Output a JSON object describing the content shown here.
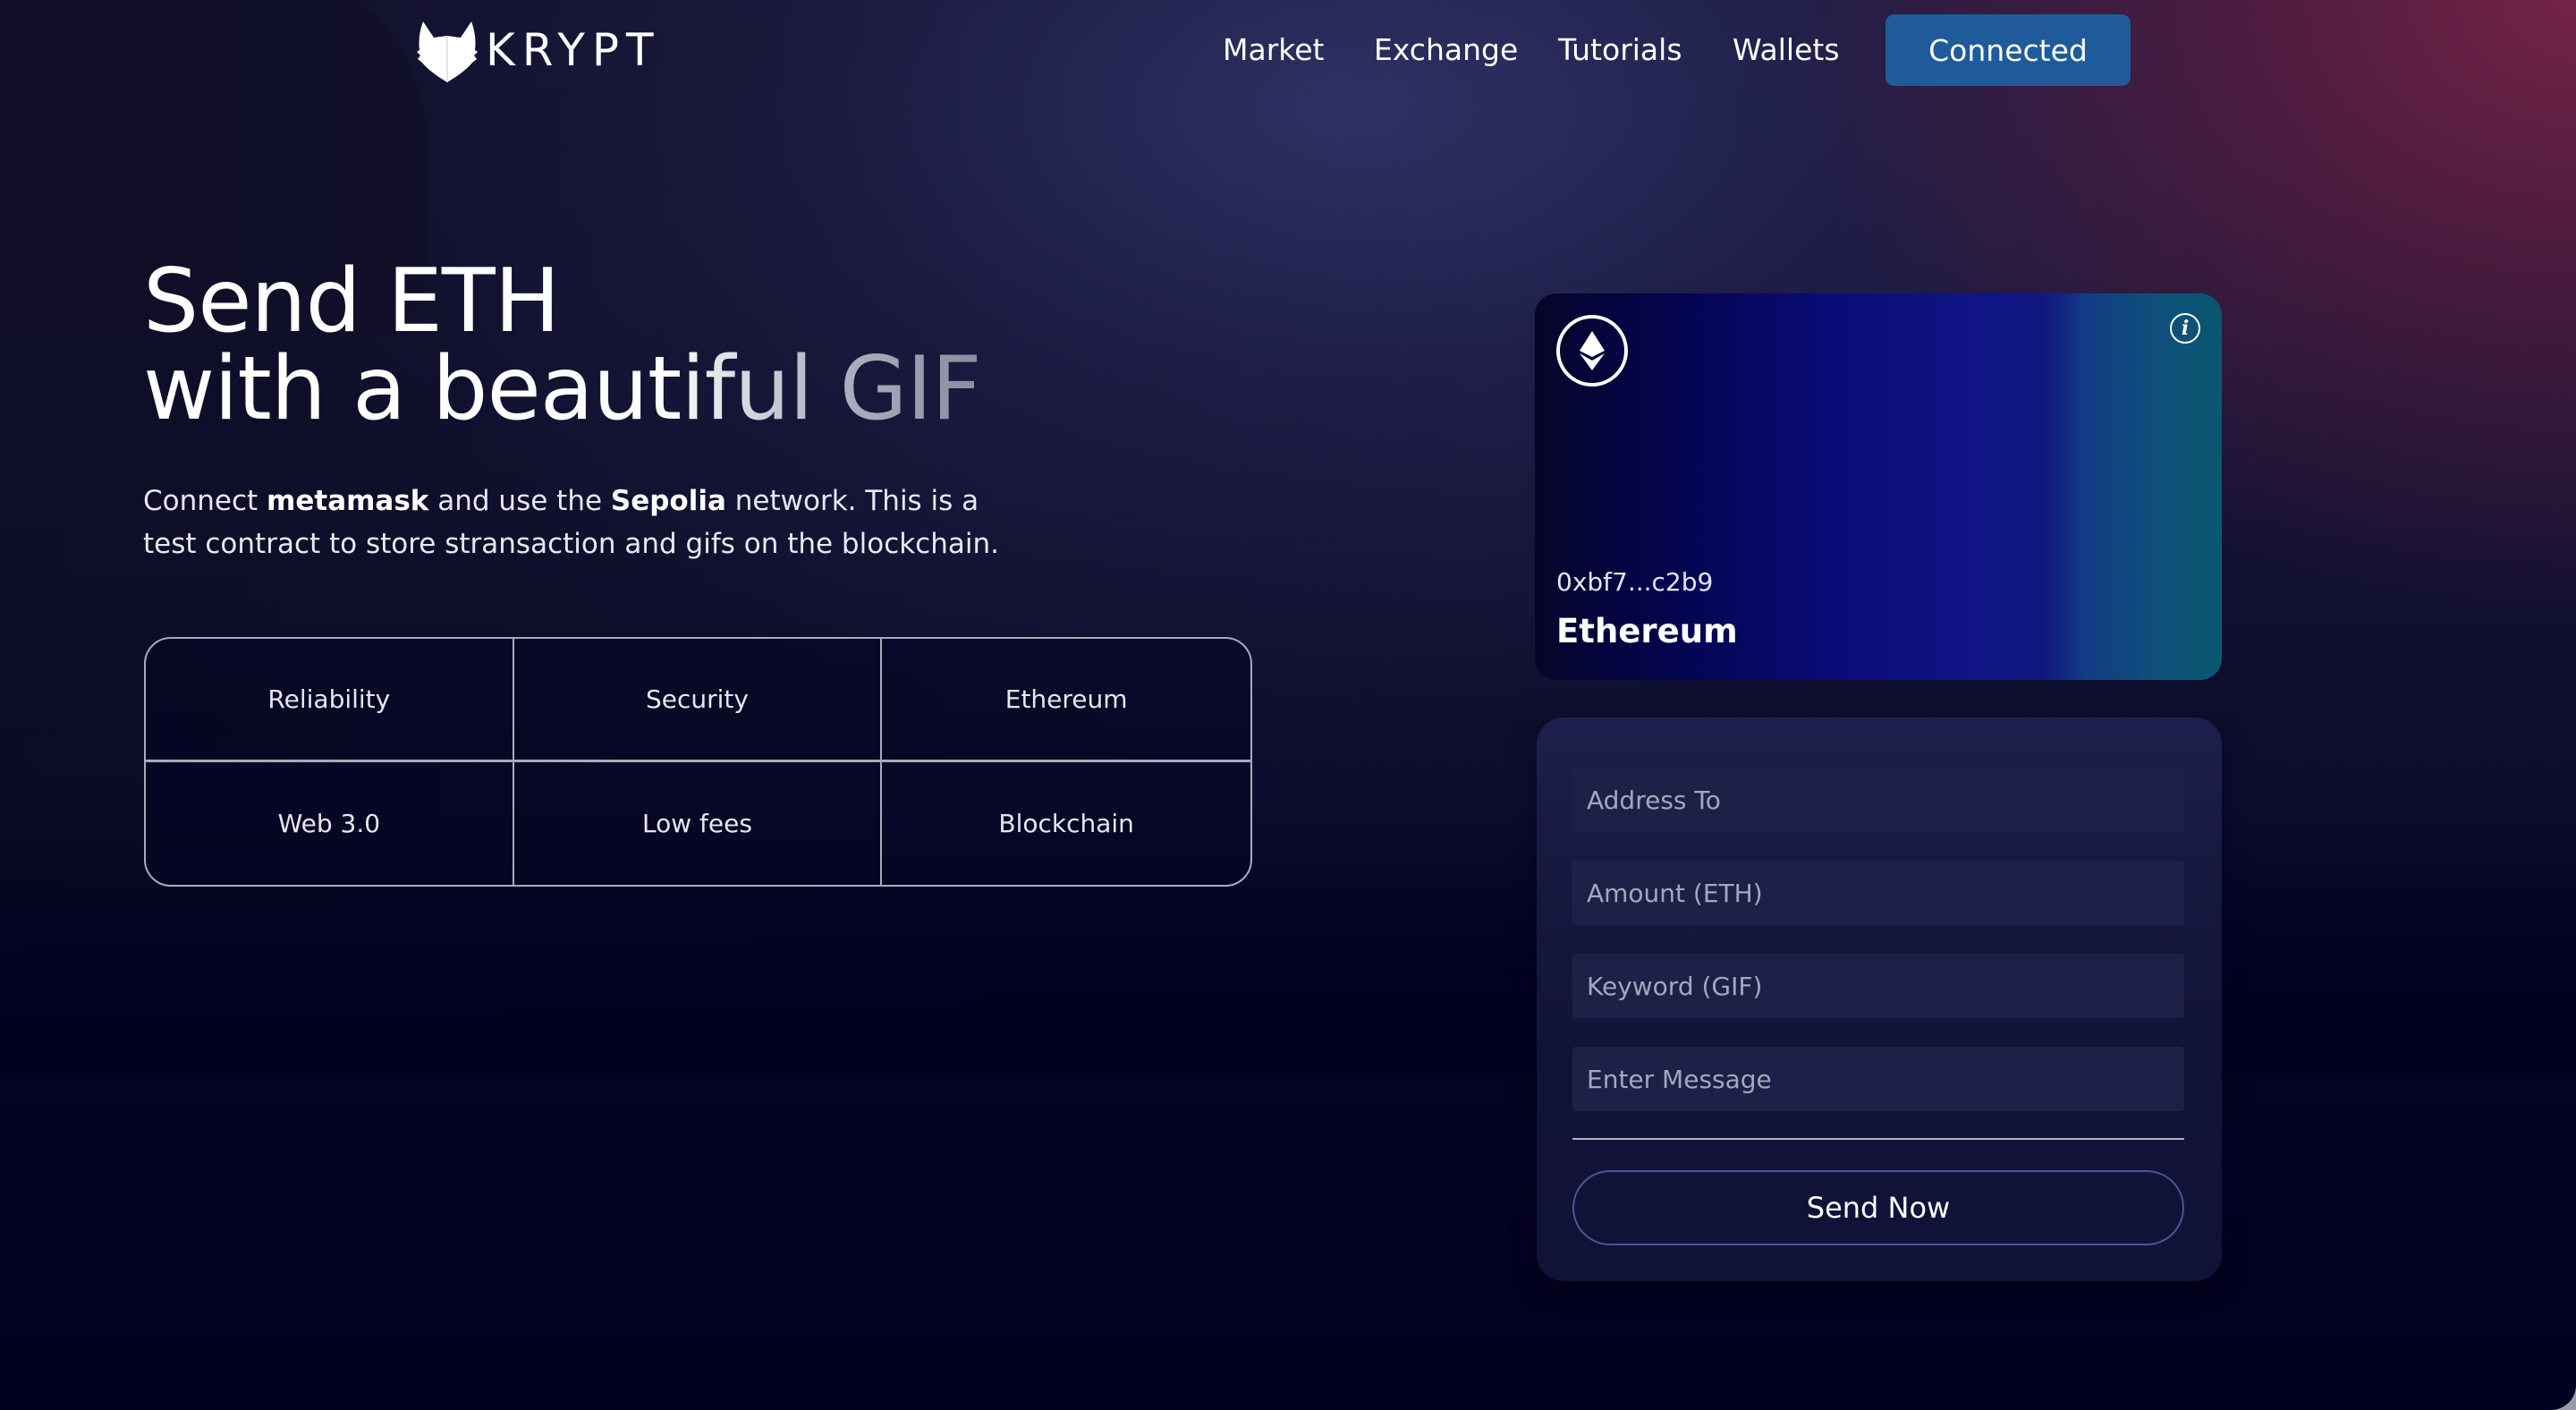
{
  "brand": {
    "name": "KRYPT",
    "logo_icon": "fox-head-icon"
  },
  "nav": {
    "items": [
      {
        "label": "Market"
      },
      {
        "label": "Exchange"
      },
      {
        "label": "Tutorials"
      },
      {
        "label": "Wallets"
      }
    ],
    "connect_label": "Connected",
    "connect_color": "#1f5b9b"
  },
  "hero": {
    "title_line1": "Send ETH",
    "title_line2": "with a beautiful GIF",
    "description": {
      "part1": "Connect ",
      "bold1": "metamask",
      "part2": " and use the ",
      "bold2": "Sepolia",
      "part3": " network. This is a test contract to store stransaction and gifs on the blockchain."
    },
    "features": [
      "Reliability",
      "Security",
      "Ethereum",
      "Web 3.0",
      "Low fees",
      "Blockchain"
    ]
  },
  "eth_card": {
    "icon": "ethereum-icon",
    "info_icon": "info-icon",
    "info_glyph": "i",
    "address": "0xbf7...c2b9",
    "network": "Ethereum"
  },
  "form": {
    "fields": [
      {
        "name": "address-to",
        "placeholder": "Address To",
        "value": ""
      },
      {
        "name": "amount",
        "placeholder": "Amount (ETH)",
        "value": ""
      },
      {
        "name": "keyword",
        "placeholder": "Keyword (GIF)",
        "value": ""
      },
      {
        "name": "message",
        "placeholder": "Enter Message",
        "value": ""
      }
    ],
    "submit_label": "Send Now"
  }
}
